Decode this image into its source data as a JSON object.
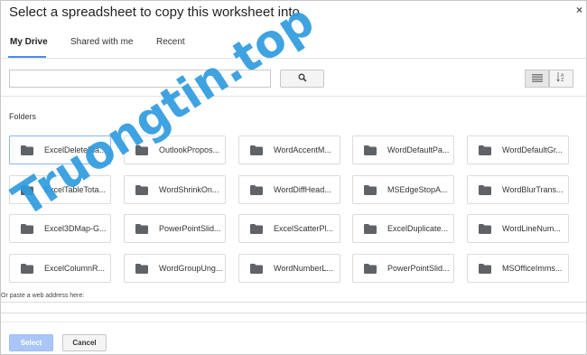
{
  "dialog": {
    "title": "Select a spreadsheet to copy this worksheet into",
    "close_label": "×"
  },
  "tabs": [
    {
      "label": "My Drive",
      "active": true
    },
    {
      "label": "Shared with me",
      "active": false
    },
    {
      "label": "Recent",
      "active": false
    }
  ],
  "search": {
    "value": "",
    "placeholder": ""
  },
  "folders_label": "Folders",
  "folders": [
    "ExcelDeleteBla...",
    "OutlookPropos...",
    "WordAccentM...",
    "WordDefaultPa...",
    "WordDefaultGr...",
    "ExcelTableTota...",
    "WordShrinkOn...",
    "WordDiffHead...",
    "MSEdgeStopA...",
    "WordBlurTrans...",
    "Excel3DMap-G...",
    "PowerPointSlid...",
    "ExcelScatterPl...",
    "ExcelDuplicate...",
    "WordLineNum...",
    "ExcelColumnR...",
    "WordGroupUng...",
    "WordNumberL...",
    "PowerPointSlid...",
    "MSOfficeImms..."
  ],
  "selected_folder_index": 0,
  "paste": {
    "label": "Or paste a web address here:",
    "value": ""
  },
  "buttons": {
    "select_label": "Select",
    "cancel_label": "Cancel"
  },
  "watermark": {
    "text": "Truongtin.top",
    "color": "#2f9be0"
  },
  "colors": {
    "accent": "#4a8af4",
    "select_button": "#aac6f6",
    "folder_icon": "#5f6368"
  }
}
